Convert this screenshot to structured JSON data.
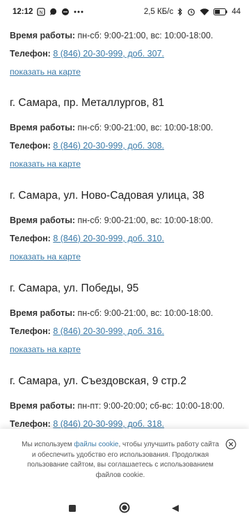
{
  "status_bar": {
    "time": "12:12",
    "speed": "2,5 КБ/с",
    "battery": "44"
  },
  "stores": [
    {
      "address": "",
      "hours_label": "Время работы:",
      "hours": " пн-сб: 9:00-21:00, вс: 10:00-18:00.",
      "phone_label": "Телефон:",
      "phone": "8 (846) 20-30-999, доб. 307.",
      "map_link": "показать на карте"
    },
    {
      "address": "г. Самара, пр. Металлургов, 81",
      "hours_label": "Время работы:",
      "hours": " пн-сб: 9:00-21:00, вс: 10:00-18:00.",
      "phone_label": "Телефон:",
      "phone": "8 (846) 20-30-999, доб. 308.",
      "map_link": "показать на карте"
    },
    {
      "address": "г. Самара, ул. Ново-Садовая улица, 38",
      "hours_label": "Время работы:",
      "hours": " пн-сб: 9:00-21:00, вс: 10:00-18:00.",
      "phone_label": "Телефон:",
      "phone": "8 (846) 20-30-999, доб. 310.",
      "map_link": "показать на карте"
    },
    {
      "address": "г. Самара, ул. Победы, 95",
      "hours_label": "Время работы:",
      "hours": " пн-сб: 9:00-21:00, вс: 10:00-18:00.",
      "phone_label": "Телефон:",
      "phone": "8 (846) 20-30-999, доб. 316.",
      "map_link": "показать на карте"
    },
    {
      "address": "г. Самара, ул. Съездовская, 9 стр.2",
      "hours_label": "Время работы:",
      "hours": " пн-пт: 9:00-20:00; сб-вс: 10:00-18:00.",
      "phone_label": "Телефон:",
      "phone": "8 (846) 20-30-999, доб. 318.",
      "map_link": ""
    }
  ],
  "cookie_banner": {
    "text_before": "Мы используем ",
    "link_text": "файлы cookie",
    "text_after": ", чтобы улучшить работу сайта и обеспечить удобство его использования. Продолжая пользование сайтом, вы соглашаетесь с использованием файлов cookie.",
    "close_icon": "close-circle-icon"
  },
  "nav_bar": {
    "icons": [
      "square-recents-icon",
      "circle-home-icon",
      "triangle-back-icon"
    ]
  },
  "colors": {
    "link": "#3a7aa8",
    "text": "#333333",
    "background": "#ffffff"
  }
}
